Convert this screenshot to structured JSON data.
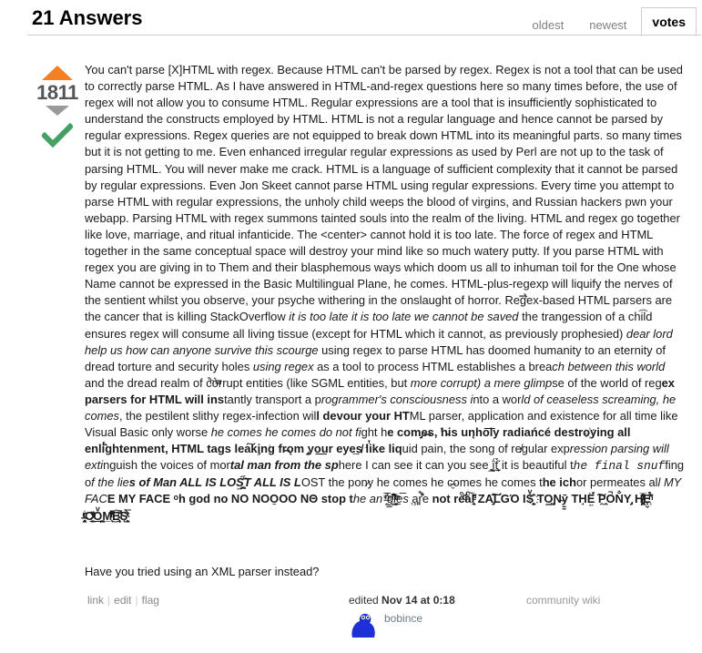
{
  "header": {
    "answers_title": "21 Answers",
    "tabs": [
      {
        "label": "oldest",
        "active": false
      },
      {
        "label": "newest",
        "active": false
      },
      {
        "label": "votes",
        "active": true
      }
    ]
  },
  "vote": {
    "count": "1811",
    "colors": {
      "upvote": "#f48024",
      "downvote": "#9a9a9a",
      "accepted": "#45a163"
    }
  },
  "answer": {
    "paragraph_main": "You can't parse [X]HTML with regex. Because HTML can't be parsed by regex. Regex is not a tool that can be used to correctly parse HTML. As I have answered in HTML-and-regex questions here so many times before, the use of regex will not allow you to consume HTML. Regular expressions are a tool that is insufficiently sophisticated to understand the constructs employed by HTML. HTML is not a regular language and hence cannot be parsed by regular expressions. Regex queries are not equipped to break down HTML into its meaningful parts. so many times but it is not getting to me. Even enhanced irregular regular expressions as used by Perl are not up to the task of parsing HTML. You will never make me crack. HTML is a language of sufficient complexity that it cannot be parsed by regular expressions. Even Jon Skeet cannot parse HTML using regular expressions. Every time you attempt to parse HTML with regular expressions, the unholy child weeps the blood of virgins, and Russian hackers pwn your webapp. Parsing HTML with regex summons tainted souls into the realm of the living. HTML and regex go together like love, marriage, and ritual infanticide. The <center> cannot hold it is too late. The force of regex and HTML together in the same conceptual space will destroy your mind like so much watery putty. If you parse HTML with regex you are giving in to Them and their blasphemous ways which doom us all to inhuman toil for the One whose Name cannot be expressed in the Basic Multilingual Plane, he comes. HTML-plus-regexp will liquify the nerves of the sentient whilst you observe, your psyche withering in the onslaught of horror. Reg̿̔̉ex-based HTML parsers are the cancer that is killing StackOverflow ",
    "it_1": "it is too late it is too late we cannot be saved",
    "seg_2": " the trangession of a chi͡ld ensures regex will consume all living tissue (except for HTML which it cannot, as previously prophesied) ",
    "it_3": "dear lord help us how can anyone survive this scourge",
    "seg_4": " using regex to parse HTML has doomed humanity to an eternity of dread torture and security holes ",
    "it_5": "using regex",
    "seg_6": " as a tool to process HTML establishes a brea",
    "it_7": "ch between this world",
    "seg_8": " and the dread realm of c͒ͪo͛ͫrrupt entities (like SGML entities, but ",
    "it_9": "more corrupt) a mere glimp",
    "seg_10": "se of the world of reg",
    "b_11": "ex parsers for HTML will ins",
    "seg_12": "tantly transport a p",
    "it_13": "rogrammer's consciousness i",
    "seg_14": "nto a wor",
    "it_15": "ld of ceaseless screaming, he comes",
    "seg_16": ", the pestilent sl",
    "seg_17": "ithy regex-infection wil",
    "b_18": "l devour your HT",
    "seg_19": "ML parser, application and existence for all time like Visual Basic only worse ",
    "it_20": "he comes he comes do not fi",
    "seg_21": "ght h",
    "b_22": "e com̡e̶s, ̕h̵is un̨ho͞ly radiańcé destro҉ying all enli̍̈́̂̈́ghtenment, HTML tags lea͠ki̧n͘g fr̶ǫm ̡yo͟ur eye͢s̸ ̛l̕ik͏e liq",
    "seg_23": "uid pain, the song of re̸gular exp",
    "it_24": "ression parsing will exti",
    "seg_25": "nguish the voices of mor",
    "it_26": "tal man from the sp",
    "seg_27": "here I can see it can you see ̲͚̖͔̙î̩́t̲͎̩̱͔́̋̀ it is beautiful t",
    "it_28": "he final snuf",
    "seg_29": "fing o",
    "it_30": "f the lie",
    "b_31": "s of Man ALL IS LOŚ͖̩͇̗̪̏̈́T ALL IS L",
    "seg_32": "OST the pon̷y he comes he c̶̮omes he comes t",
    "b_33": "he ich",
    "seg_34": "or permeates al",
    "it_35": "l MY FAC",
    "b_36": "E MY FACE ᵒh god no NO NOO̼O​O NΘ stop t",
    "it_37": "he an​*̶͑̾̾​̅ͫ͏̙̤g͇̫͛͆̾ͫ̑͆l͖͉̗̩̳̟̍ͫͥͨe̠̅s",
    "seg_38": " ͎a̧͈͖r̽̾̈́͒͑e",
    "b_39": " n​ot rè̑ͧ̌aͨl̘̝̙̃ͤ͂̾̆ ZA̡͊͠͝LGΌ ISͮ̂҉̯͈͕̹̘̱ TO͇̹̺ͅƝ̴ȳ̳ TH̘Ë͖́̉ ͠P̯͍̭O̚​N̐Y̡ H̸̡̪̯ͨ͊̽̅̾̎Ȩ̬̩̾͛ͪ̈́̀́͘ ̶̧̨̱̹̭̯ͧ̾ͬC̷̙̲̝͖ͭ̏ͥͮ͟Oͮ͏̮̪̝͍M̲̖͊̒ͪͩͬ̚̚͜Ȇ̴̟̟͙̞ͩ͌͝S̨̥̫͎̭ͯ̿̔̀ͅ",
    "followup": "Have you tried using an XML parser instead?"
  },
  "footer": {
    "menu": {
      "link": "link",
      "edit": "edit",
      "flag": "flag",
      "sep": "|"
    },
    "edited_label": "edited",
    "edited_when": "Nov 14 at 0:18",
    "user_name": "bobince",
    "community_wiki": "community wiki",
    "avatar_color": "#1f2fd6"
  }
}
